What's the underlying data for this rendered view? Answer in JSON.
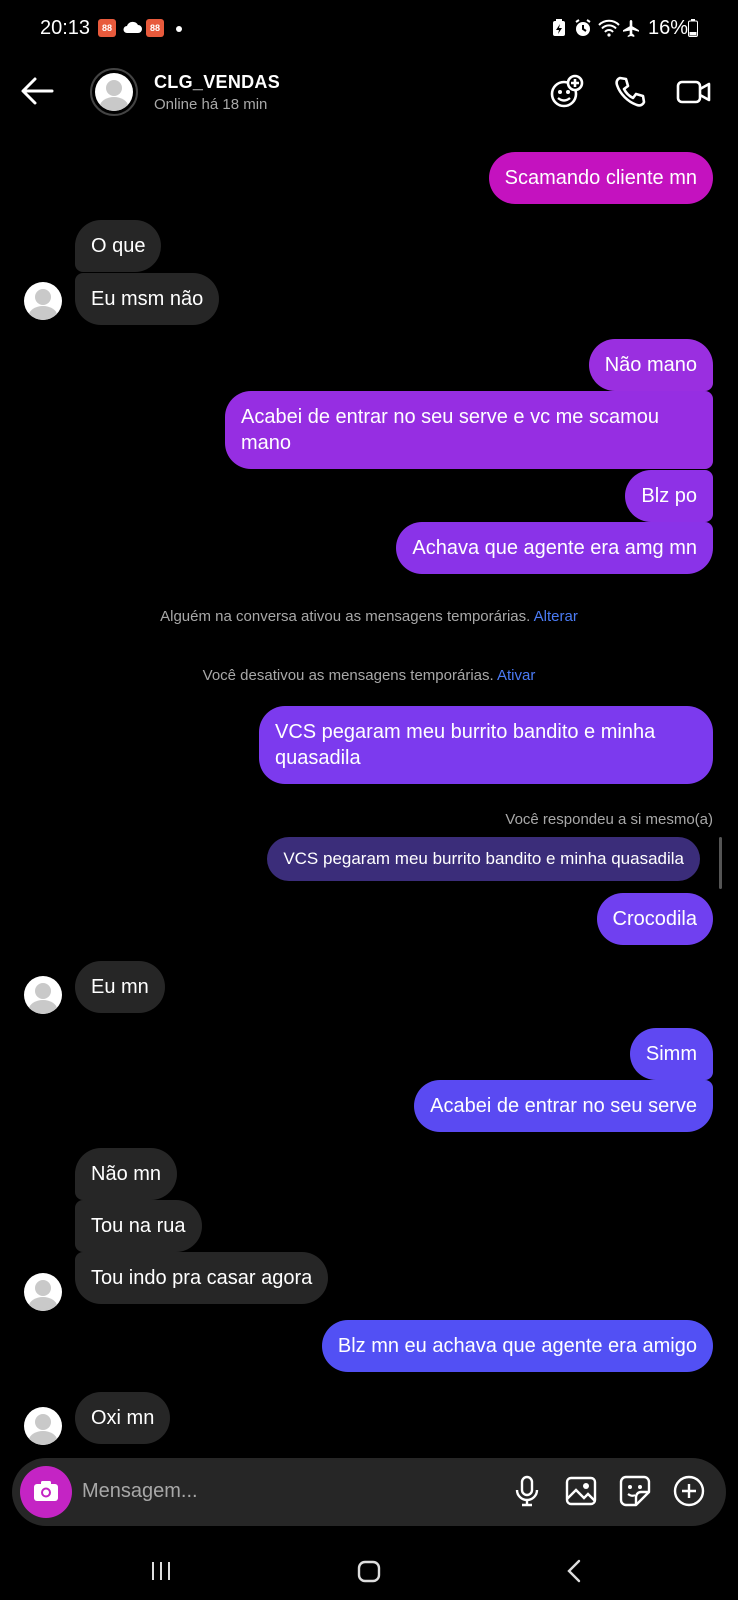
{
  "status_bar": {
    "time": "20:13",
    "battery": "16%",
    "app_badge": "88"
  },
  "header": {
    "name": "CLG_VENDAS",
    "status": "Online há 18 min"
  },
  "messages": [
    {
      "from": "me",
      "text": "Scamando cliente mn",
      "color": "#c412bf"
    },
    {
      "from": "them",
      "text": "O que"
    },
    {
      "from": "them",
      "text": "Eu msm não"
    },
    {
      "from": "me",
      "text": "Não mano",
      "color": "#9a2fe0"
    },
    {
      "from": "me",
      "text": "Acabei de entrar no seu serve e vc me scamou mano",
      "color": "#962ee2"
    },
    {
      "from": "me",
      "text": "Blz po",
      "color": "#8e31e6"
    },
    {
      "from": "me",
      "text": "Achava que agente era amg mn",
      "color": "#8a33e8"
    },
    {
      "from": "me",
      "text": "VCS pegaram meu burrito bandito e minha quasadila",
      "color": "#7c3aee"
    },
    {
      "from": "me",
      "text": "Crocodila",
      "color": "#7040f0"
    },
    {
      "from": "them",
      "text": "Eu mn"
    },
    {
      "from": "me",
      "text": "Simm",
      "color": "#5f48f2"
    },
    {
      "from": "me",
      "text": "Acabei de entrar no seu serve",
      "color": "#5a4af2"
    },
    {
      "from": "them",
      "text": "Não mn"
    },
    {
      "from": "them",
      "text": "Tou na rua"
    },
    {
      "from": "them",
      "text": "Tou indo pra casar agora"
    },
    {
      "from": "me",
      "text": "Blz mn eu achava que agente era amigo",
      "color": "#5250f4"
    },
    {
      "from": "them",
      "text": "Oxi mn"
    }
  ],
  "system_notices": [
    {
      "text": "Alguém na conversa ativou as mensagens temporárias.",
      "link": "Alterar"
    },
    {
      "text": "Você desativou as mensagens temporárias.",
      "link": "Ativar"
    }
  ],
  "reply": {
    "label": "Você respondeu a si mesmo(a)",
    "quote": "VCS pegaram meu burrito bandito e minha quasadila"
  },
  "composer": {
    "placeholder": "Mensagem..."
  },
  "icons": {
    "back": "arrow-left-icon",
    "add_member": "add-people-icon",
    "call": "phone-icon",
    "video": "video-icon",
    "camera": "camera-icon",
    "mic": "microphone-icon",
    "gallery": "image-icon",
    "sticker": "sticker-icon",
    "plus": "plus-circle-icon"
  }
}
